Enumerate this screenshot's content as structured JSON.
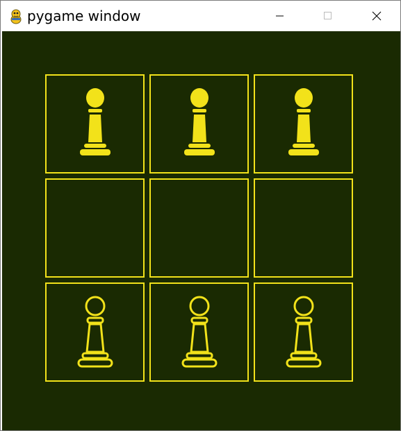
{
  "window": {
    "title": "pygame window",
    "controls": [
      "minimize",
      "maximize",
      "close"
    ]
  },
  "colors": {
    "background": "#1a2a02",
    "accent": "#f2e21a",
    "titlebar": "#ffffff"
  },
  "board": {
    "rows": [
      [
        {
          "piece": "pawn",
          "style": "filled"
        },
        {
          "piece": "pawn",
          "style": "filled"
        },
        {
          "piece": "pawn",
          "style": "filled"
        }
      ],
      [
        {
          "piece": null
        },
        {
          "piece": null
        },
        {
          "piece": null
        }
      ],
      [
        {
          "piece": "pawn",
          "style": "outline"
        },
        {
          "piece": "pawn",
          "style": "outline"
        },
        {
          "piece": "pawn",
          "style": "outline"
        }
      ]
    ]
  }
}
